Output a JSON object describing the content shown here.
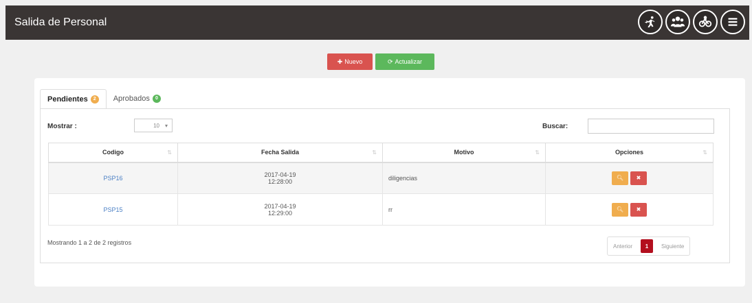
{
  "header": {
    "title": "Salida de Personal",
    "icons": [
      "exit-runner-icon",
      "users-icon",
      "bicycle-group-icon",
      "menu-icon"
    ]
  },
  "toolbar": {
    "new_label": "Nuevo",
    "refresh_label": "Actualizar"
  },
  "tabs": [
    {
      "label": "Pendientes",
      "badge": "2"
    },
    {
      "label": "Aprobados",
      "badge": "0"
    }
  ],
  "controls": {
    "show_label": "Mostrar :",
    "show_value": "10",
    "search_label": "Buscar:",
    "search_value": ""
  },
  "table": {
    "columns": [
      "Codigo",
      "Fecha Salida",
      "Motivo",
      "Opciones"
    ],
    "rows": [
      {
        "code": "PSP16",
        "date": "2017-04-19",
        "time": "12:28:00",
        "motivo": "diligencias"
      },
      {
        "code": "PSP15",
        "date": "2017-04-19",
        "time": "12:29:00",
        "motivo": "rr"
      }
    ]
  },
  "footer": {
    "info": "Mostrando 1 a 2 de 2 registros",
    "prev": "Anterior",
    "page": "1",
    "next": "Siguiente"
  },
  "colors": {
    "topbar": "#3a3534",
    "danger": "#d9534f",
    "success": "#5cb85c",
    "warning": "#f0ad4e",
    "active_page": "#b30f1e"
  }
}
